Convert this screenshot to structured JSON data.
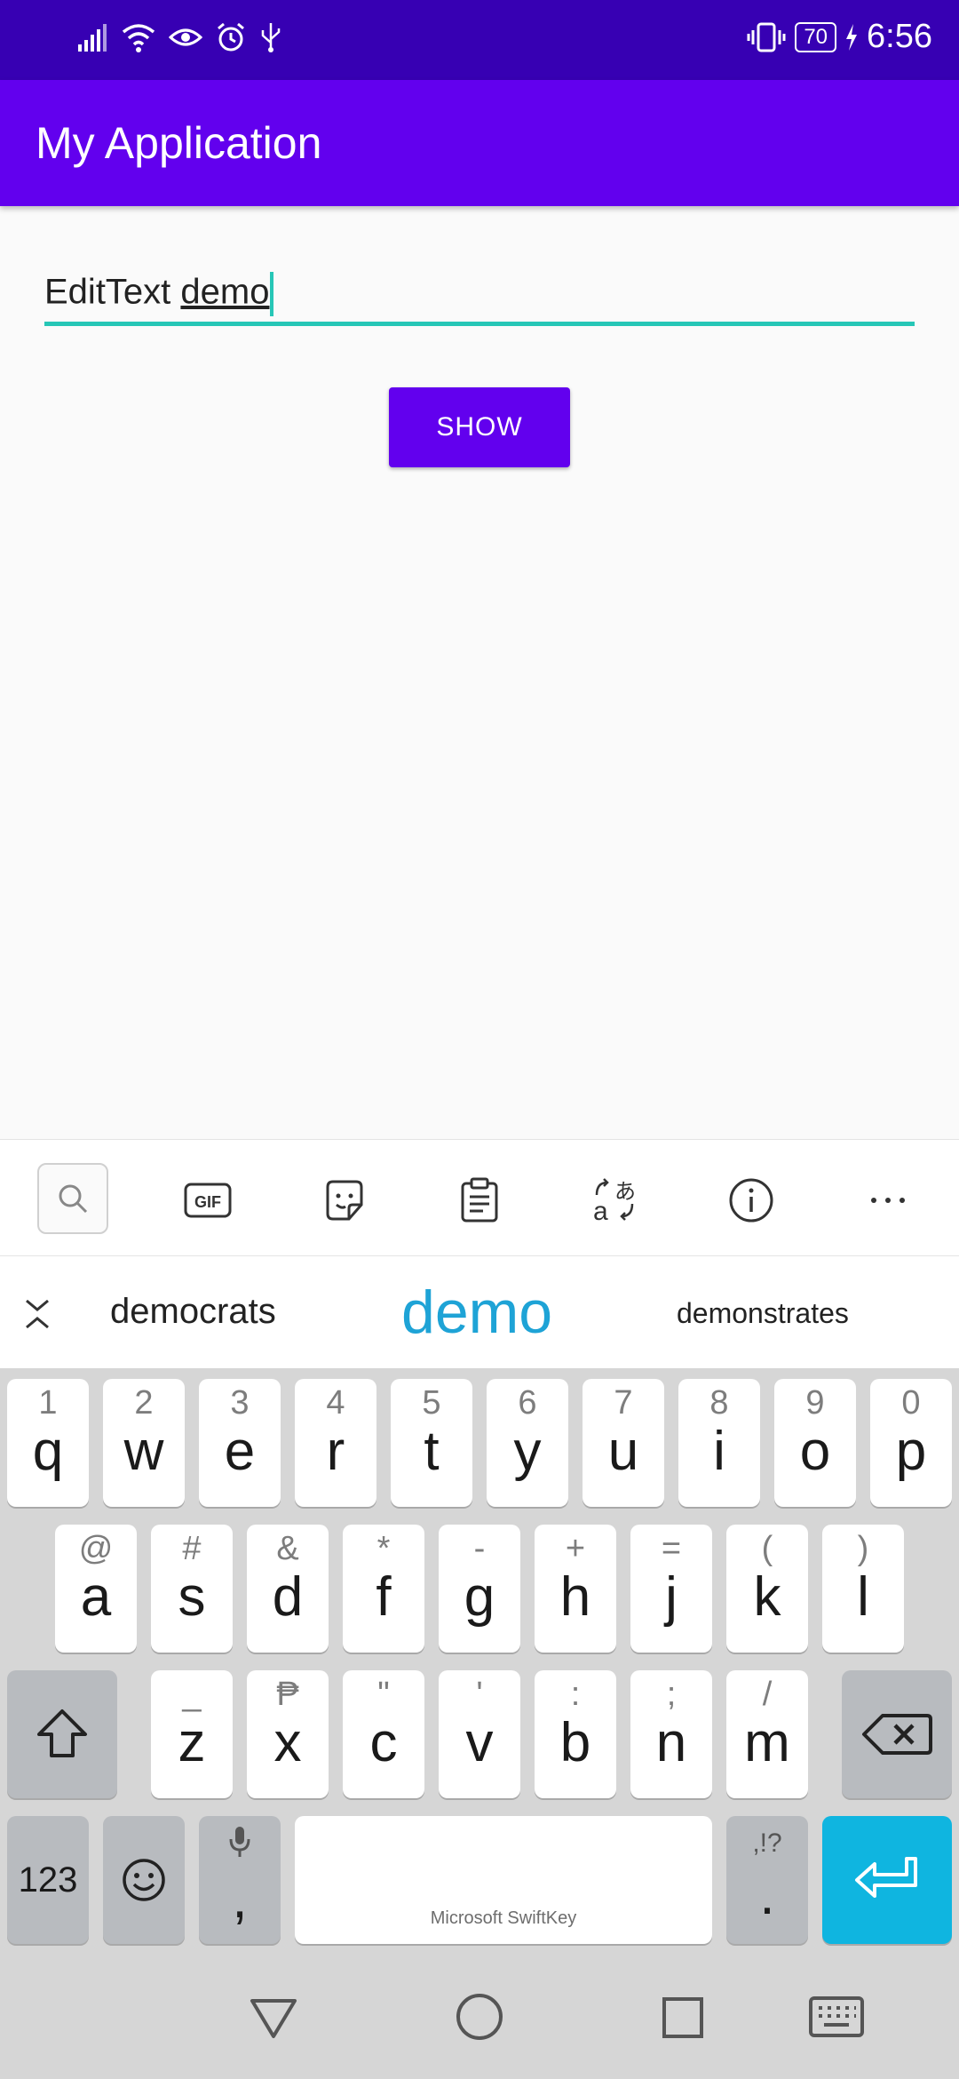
{
  "status_bar": {
    "battery_level": "70",
    "time": "6:56",
    "icons": [
      "signal-icon",
      "wifi-icon",
      "eye-icon",
      "alarm-icon",
      "usb-icon",
      "vibrate-icon",
      "charging-icon"
    ]
  },
  "app_bar": {
    "title": "My Application"
  },
  "main": {
    "edit_text_prefix": "EditText ",
    "edit_text_composing": "demo",
    "show_button": "SHOW"
  },
  "keyboard_toolbar": {
    "icons": [
      "search-icon",
      "gif-icon",
      "sticker-icon",
      "clipboard-icon",
      "translate-icon",
      "info-icon",
      "more-icon"
    ],
    "gif_label": "GIF"
  },
  "suggestions": {
    "left": "democrats",
    "center": "demo",
    "right": "demonstrates"
  },
  "keyboard": {
    "row1": [
      {
        "primary": "q",
        "secondary": "1"
      },
      {
        "primary": "w",
        "secondary": "2"
      },
      {
        "primary": "e",
        "secondary": "3"
      },
      {
        "primary": "r",
        "secondary": "4"
      },
      {
        "primary": "t",
        "secondary": "5"
      },
      {
        "primary": "y",
        "secondary": "6"
      },
      {
        "primary": "u",
        "secondary": "7"
      },
      {
        "primary": "i",
        "secondary": "8"
      },
      {
        "primary": "o",
        "secondary": "9"
      },
      {
        "primary": "p",
        "secondary": "0"
      }
    ],
    "row2": [
      {
        "primary": "a",
        "secondary": "@"
      },
      {
        "primary": "s",
        "secondary": "#"
      },
      {
        "primary": "d",
        "secondary": "&"
      },
      {
        "primary": "f",
        "secondary": "*"
      },
      {
        "primary": "g",
        "secondary": "-"
      },
      {
        "primary": "h",
        "secondary": "+"
      },
      {
        "primary": "j",
        "secondary": "="
      },
      {
        "primary": "k",
        "secondary": "("
      },
      {
        "primary": "l",
        "secondary": ")"
      }
    ],
    "row3": [
      {
        "primary": "z",
        "secondary": "_"
      },
      {
        "primary": "x",
        "secondary": "₱"
      },
      {
        "primary": "c",
        "secondary": "\""
      },
      {
        "primary": "v",
        "secondary": "'"
      },
      {
        "primary": "b",
        "secondary": ":"
      },
      {
        "primary": "n",
        "secondary": ";"
      },
      {
        "primary": "m",
        "secondary": "/"
      }
    ],
    "numbers_key": "123",
    "comma_key": ",",
    "period_key": ".",
    "period_secondary": ",!?",
    "space_label": "Microsoft SwiftKey"
  },
  "colors": {
    "status_bar": "#3700b3",
    "app_bar": "#6200ee",
    "accent": "#26c6b6",
    "suggestion_highlight": "#1ea3d6",
    "enter_key": "#0fb5e0"
  }
}
